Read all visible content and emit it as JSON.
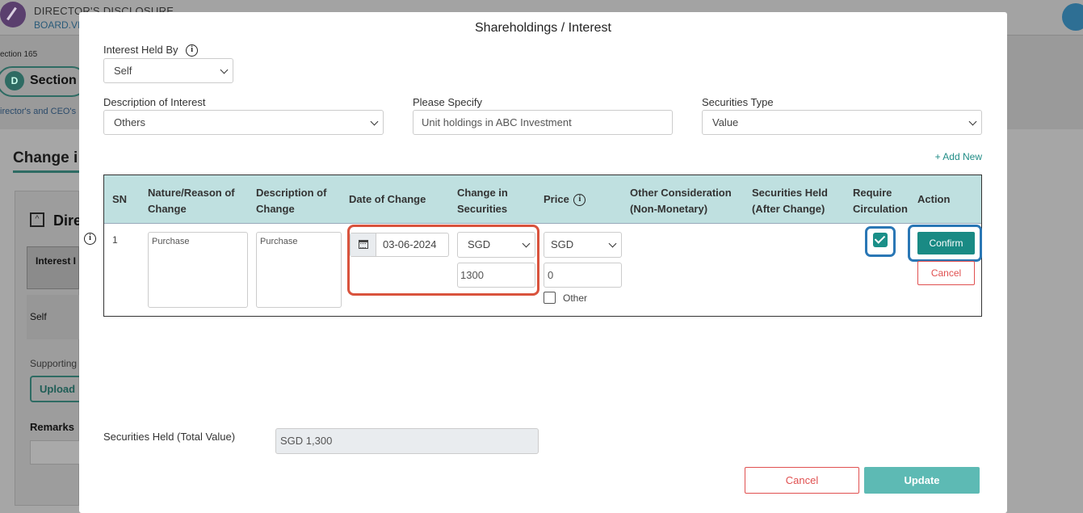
{
  "background": {
    "brand_line1": "DIRECTOR'S DISCLOSURE",
    "brand_line2": "BOARD.VI",
    "section_small": "ection 165",
    "section_badge": "D",
    "section_label": "Section",
    "subtitle": "irector's and CEO's",
    "change_heading": "Change i",
    "collapse_symbol": "^",
    "dir_heading": "Dire",
    "table_header": "Interest I",
    "table_cell": "Self",
    "supporting": "Supporting",
    "upload": "Upload",
    "remarks": "Remarks"
  },
  "modal": {
    "title": "Shareholdings / Interest",
    "interest_held_by": {
      "label": "Interest Held By",
      "value": "Self"
    },
    "description_of_interest": {
      "label": "Description of Interest",
      "value": "Others"
    },
    "please_specify": {
      "label": "Please Specify",
      "value": "Unit holdings in ABC Investment"
    },
    "securities_type": {
      "label": "Securities Type",
      "value": "Value"
    },
    "add_new": "+ Add New",
    "table": {
      "headers": {
        "sn": "SN",
        "nature_l1": "Nature/Reason of",
        "nature_l2": "Change",
        "desc_l1": "Description of",
        "desc_l2": "Change",
        "date": "Date of Change",
        "chg_l1": "Change in",
        "chg_l2": "Securities",
        "price": "Price",
        "other_l1": "Other Consideration",
        "other_l2": "(Non-Monetary)",
        "held_l1": "Securities Held",
        "held_l2": "(After Change)",
        "req_l1": "Require",
        "req_l2": "Circulation",
        "action": "Action"
      },
      "row": {
        "sn": "1",
        "nature": "Purchase",
        "description": "Purchase",
        "date": "03-06-2024",
        "change_currency": "SGD",
        "change_amount": "1300",
        "price_currency": "SGD",
        "price_amount": "0",
        "other_label": "Other",
        "require_circulation": true,
        "confirm": "Confirm",
        "cancel": "Cancel"
      }
    },
    "total": {
      "label": "Securities Held (Total Value)",
      "value": "SGD  1,300"
    },
    "buttons": {
      "cancel": "Cancel",
      "update": "Update"
    }
  }
}
